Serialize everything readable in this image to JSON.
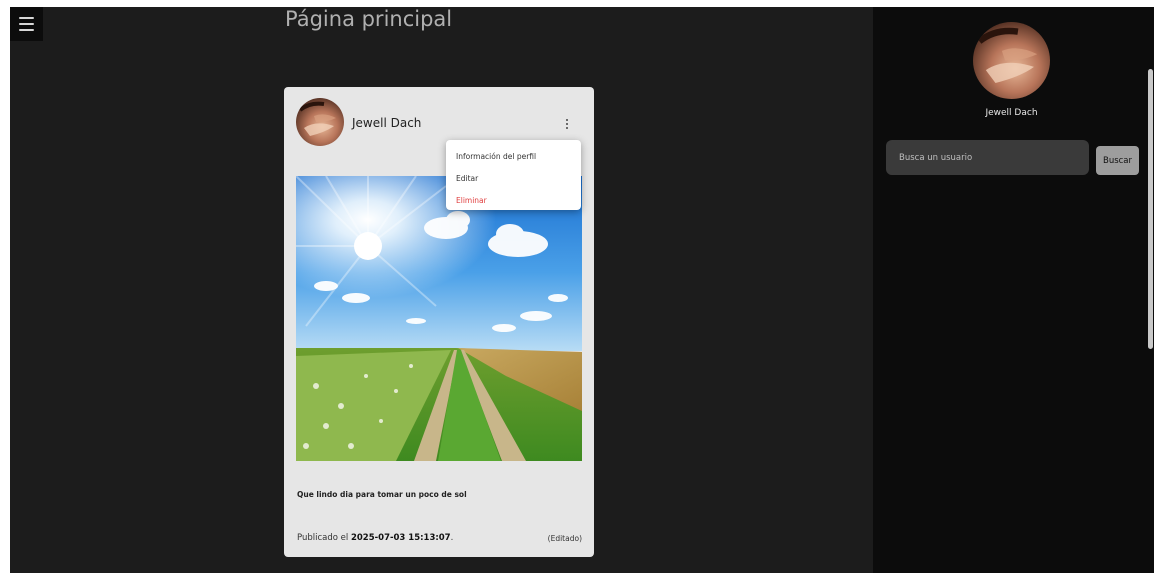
{
  "page": {
    "title": "Página principal"
  },
  "nav": {
    "menu_icon": "hamburger-icon"
  },
  "post": {
    "author": "Jewell Dach",
    "caption": "Que lindo dia para tomar un poco de sol",
    "published_prefix": "Publicado el",
    "published_datetime": "2025-07-03 15:13:07",
    "published_suffix": ".",
    "edited_label": "(Editado)",
    "menu": {
      "icon": "kebab-menu-icon",
      "items": [
        {
          "label": "Información del perfil"
        },
        {
          "label": "Editar"
        },
        {
          "label": "Eliminar",
          "color": "#e04040"
        }
      ]
    }
  },
  "sidebar": {
    "user_name": "Jewell Dach",
    "search": {
      "placeholder": "Busca un usuario",
      "value": ""
    },
    "search_button": "Buscar"
  },
  "colors": {
    "background": "#1c1c1c",
    "sidebar": "#0c0c0c",
    "card": "#e6e6e6",
    "danger": "#e04040",
    "button": "#9d9d9d"
  }
}
